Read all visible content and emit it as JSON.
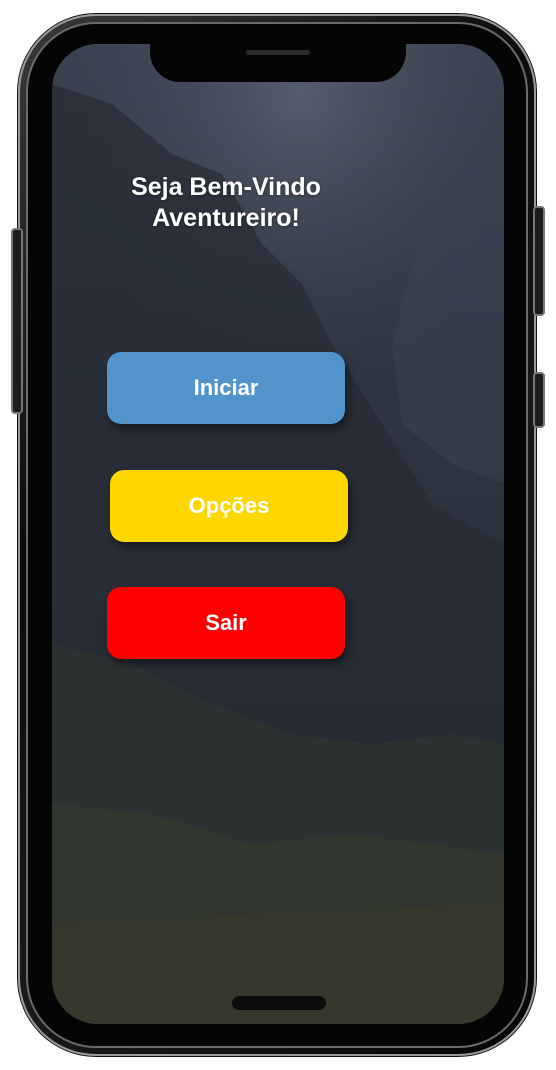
{
  "welcome": {
    "line1": "Seja Bem-Vindo",
    "line2": "Aventureiro!"
  },
  "menu": {
    "start_label": "Iniciar",
    "options_label": "Opções",
    "exit_label": "Sair"
  },
  "colors": {
    "start": "#5393cc",
    "options": "#ffd700",
    "exit": "#ff0000",
    "text": "#ffffff",
    "background": "#2d3340"
  }
}
